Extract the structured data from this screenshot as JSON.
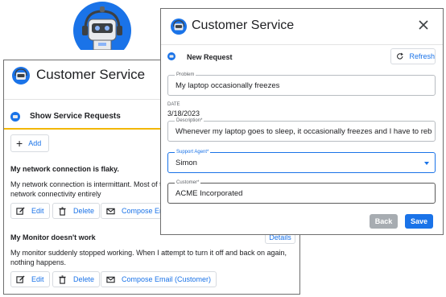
{
  "app": {
    "title": "Customer Service"
  },
  "colors": {
    "accent": "#1a73e8",
    "tab_underline": "#f2b705",
    "mascot_bg": "#1a73e8"
  },
  "back_window": {
    "title": "Customer Service",
    "tab_label": "Show Service Requests",
    "add_label": "Add",
    "cards": [
      {
        "title": "My network connection is flaky.",
        "body": "My network connection is intermittant. Most of the time it works fine, but sometimes I lose network connectivity entirely",
        "actions": {
          "edit": "Edit",
          "delete": "Delete",
          "compose": "Compose Email (Customer)"
        }
      },
      {
        "title": "My Monitor doesn't work",
        "body": "My monitor suddenly stopped working. When I attempt to turn it off and back on again, nothing happens.",
        "details": "Details",
        "actions": {
          "edit": "Edit",
          "delete": "Delete",
          "compose": "Compose Email (Customer)"
        }
      }
    ]
  },
  "dialog": {
    "title": "Customer Service",
    "section_title": "New Request",
    "refresh_label": "Refresh",
    "fields": {
      "problem": {
        "label": "Problem",
        "value": "My laptop occasionally freezes"
      },
      "date": {
        "label": "DATE",
        "value": "3/18/2023"
      },
      "description": {
        "label": "Description*",
        "value": "Whenever my laptop goes to sleep, it occasionally freezes and I have to reboot it"
      },
      "support_agent": {
        "label": "Support Agent*",
        "value": "Simon"
      },
      "customer": {
        "label": "Customer*",
        "value": "ACME Incorporated"
      }
    },
    "back_label": "Back",
    "save_label": "Save"
  },
  "icons": [
    "robot-mascot-icon",
    "logo-icon",
    "close-icon",
    "refresh-icon",
    "plus-icon",
    "edit-icon",
    "trash-icon",
    "mail-icon",
    "chevron-down-icon"
  ]
}
